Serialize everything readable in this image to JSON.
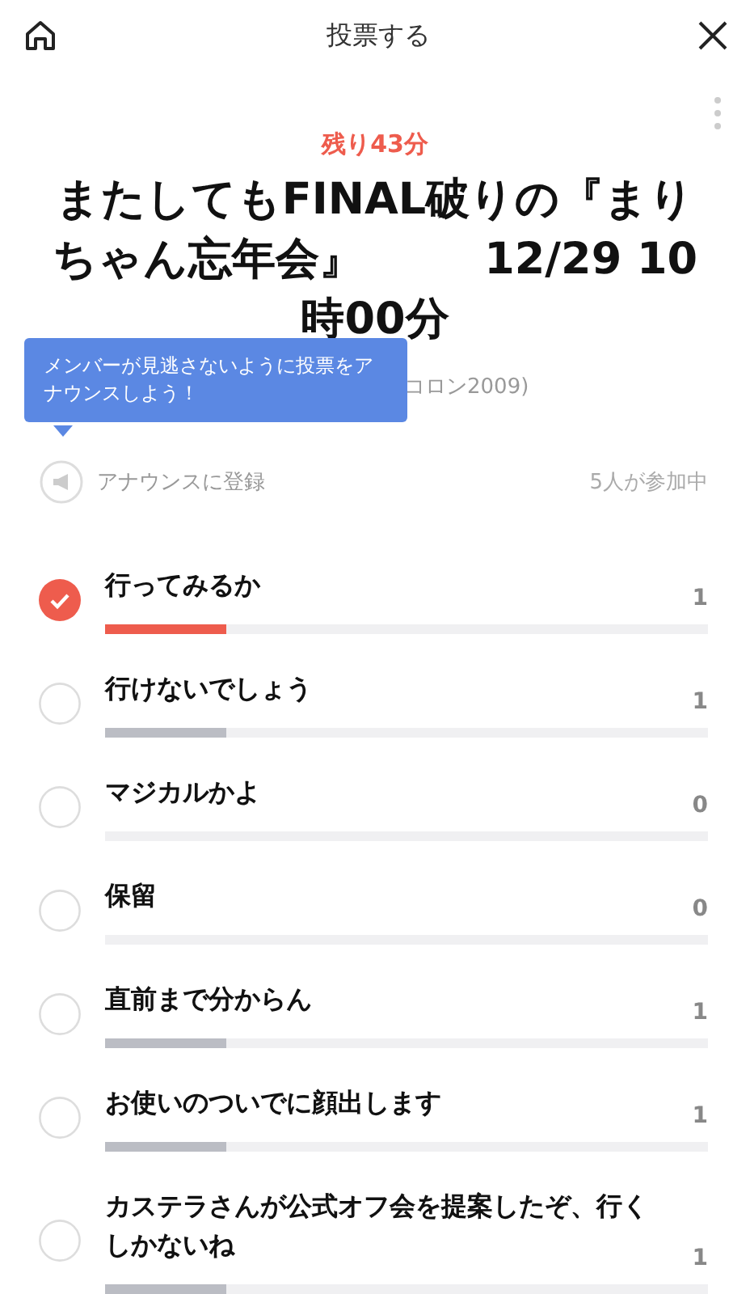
{
  "header": {
    "title": "投票する"
  },
  "poll": {
    "remaining": "残り43分",
    "title": "またしてもFINAL破りの『まりちゃん忘年会』        12/29 10時00分",
    "subtitle": "コロン2009)"
  },
  "tooltip": {
    "text": "メンバーが見逃さないように投票をアナウンスしよう！"
  },
  "announce": {
    "label": "アナウンスに登録",
    "participants": "5人が参加中"
  },
  "options": [
    {
      "label": "行ってみるか",
      "count": "1",
      "selected": true,
      "level": 0.2
    },
    {
      "label": "行けないでしょう",
      "count": "1",
      "selected": false,
      "level": 0.2
    },
    {
      "label": "マジカルかよ",
      "count": "0",
      "selected": false
    },
    {
      "label": "保留",
      "count": "0",
      "selected": false
    },
    {
      "label": "直前まで分からん",
      "count": "1",
      "selected": false,
      "level": 0.2
    },
    {
      "label": "お使いのついでに顔出します",
      "count": "1",
      "selected": false,
      "level": 0.2
    },
    {
      "label": "カステラさんが公式オフ会を提案したぞ、行くしかないね",
      "count": "1",
      "selected": false,
      "level": 0.2
    }
  ]
}
